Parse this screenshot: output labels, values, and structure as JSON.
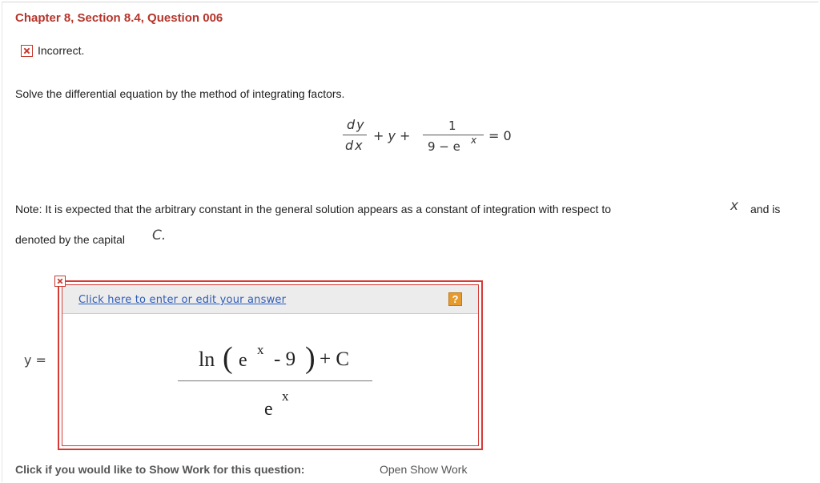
{
  "question": {
    "title": "Chapter 8, Section 8.4, Question 006",
    "status_text": "Incorrect.",
    "instruction": "Solve the differential equation by the method of integrating factors."
  },
  "equation": {
    "dy": "dy",
    "dx": "dx",
    "middle": "+ y +",
    "numerator": "1",
    "denominator": "9 − e",
    "exponent": "x",
    "rhs": "= 0"
  },
  "note": {
    "line1": "Note: It is expected that the arbitrary constant in the general solution appears as a constant of integration with respect to",
    "var_x": "x",
    "and_is": "and is",
    "line2": "denoted by the capital",
    "var_c": "C."
  },
  "answer": {
    "edit_link": "Click here to enter or edit your answer",
    "help": "?",
    "y_label": "y =",
    "numerator": {
      "ln": "ln",
      "open_paren": "(",
      "base": "e",
      "exponent": "x",
      "minus_nine": "- 9",
      "close_paren": ")",
      "plus_c": "+ C"
    },
    "denominator": {
      "base": "e",
      "exponent": "x"
    }
  },
  "show_work": {
    "label": "Click if you would like to Show Work for this question:",
    "link": "Open Show Work"
  },
  "colors": {
    "title": "#b5352b",
    "error_border": "#d63a34",
    "link": "#2d5bb8",
    "help_icon": "#e59a2b",
    "header_bg": "#ececec"
  },
  "icons": {
    "status": "incorrect-x-icon",
    "field_error": "field-error-x-icon",
    "help": "help-question-icon"
  }
}
